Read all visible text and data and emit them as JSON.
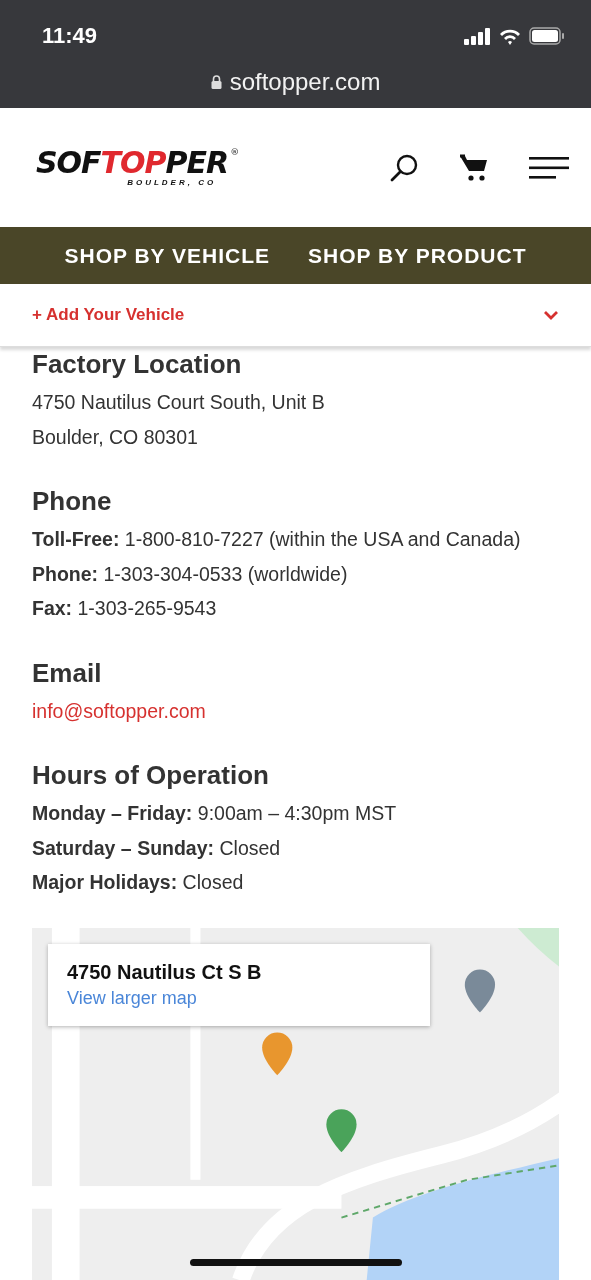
{
  "status_bar": {
    "time": "11:49"
  },
  "browser": {
    "url": "softopper.com"
  },
  "header": {
    "logo": {
      "before": "SOF",
      "accent": "TOP",
      "after": "PER",
      "mark": "®",
      "tagline": "BOULDER, CO"
    }
  },
  "nav": [
    {
      "label": "SHOP BY VEHICLE"
    },
    {
      "label": "SHOP BY PRODUCT"
    }
  ],
  "vehicle_bar": {
    "label": "+ Add Your Vehicle",
    "expanded": false
  },
  "sections": [
    {
      "heading": "Factory Location",
      "lines": [
        {
          "kind": "text",
          "text": "4750 Nautilus Court South, Unit B"
        },
        {
          "kind": "text",
          "text": "Boulder, CO 80301"
        }
      ]
    },
    {
      "heading": "Phone",
      "lines": [
        {
          "kind": "text",
          "text": "**Toll-Free:** 1-800-810-7227 (within the USA and Canada)"
        },
        {
          "kind": "text",
          "text": "**Phone:** 1-303-304-0533 (worldwide)"
        },
        {
          "kind": "text",
          "text": "**Fax:** 1-303-265-9543"
        }
      ]
    },
    {
      "heading": "Email",
      "lines": [
        {
          "kind": "link",
          "text": "info@softopper.com"
        }
      ]
    },
    {
      "heading": "Hours of Operation",
      "lines": [
        {
          "kind": "text",
          "text": "**Monday – Friday:** 9:00am – 4:30pm MST"
        },
        {
          "kind": "text",
          "text": "**Saturday – Sunday:** Closed"
        },
        {
          "kind": "text",
          "text": "**Major Holidays:** Closed"
        }
      ]
    }
  ],
  "map": {
    "kind": "picture",
    "place": "4750 Nautilus Ct S B",
    "link": "View larger map"
  }
}
